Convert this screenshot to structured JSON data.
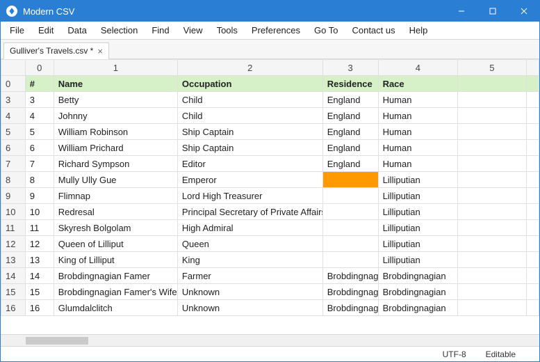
{
  "app": {
    "title": "Modern CSV"
  },
  "menu": [
    "File",
    "Edit",
    "Data",
    "Selection",
    "Find",
    "View",
    "Tools",
    "Preferences",
    "Go To",
    "Contact us",
    "Help"
  ],
  "tab": {
    "label": "Gulliver's Travels.csv *"
  },
  "colHeaders": [
    "0",
    "1",
    "2",
    "3",
    "4",
    "5"
  ],
  "headerRow": {
    "idx": "0",
    "c0": "#",
    "c1": "Name",
    "c2": "Occupation",
    "c3": "Residence",
    "c4": "Race"
  },
  "rows": [
    {
      "idx": "3",
      "c0": "3",
      "c1": "Betty",
      "c2": "Child",
      "c3": "England",
      "c4": "Human"
    },
    {
      "idx": "4",
      "c0": "4",
      "c1": "Johnny",
      "c2": "Child",
      "c3": "England",
      "c4": "Human"
    },
    {
      "idx": "5",
      "c0": "5",
      "c1": "William Robinson",
      "c2": "Ship Captain",
      "c3": "England",
      "c4": "Human"
    },
    {
      "idx": "6",
      "c0": "6",
      "c1": "William Prichard",
      "c2": "Ship Captain",
      "c3": "England",
      "c4": "Human"
    },
    {
      "idx": "7",
      "c0": "7",
      "c1": "Richard Sympson",
      "c2": "Editor",
      "c3": "England",
      "c4": "Human"
    },
    {
      "idx": "8",
      "c0": "8",
      "c1": "Mully Ully Gue",
      "c2": "Emperor",
      "c3": "",
      "c4": "Lilliputian",
      "hl3": true
    },
    {
      "idx": "9",
      "c0": "9",
      "c1": "Flimnap",
      "c2": "Lord High Treasurer",
      "c3": "",
      "c4": "Lilliputian"
    },
    {
      "idx": "10",
      "c0": "10",
      "c1": "Redresal",
      "c2": "Principal Secretary of Private Affairs",
      "c3": "",
      "c4": "Lilliputian"
    },
    {
      "idx": "11",
      "c0": "11",
      "c1": "Skyresh Bolgolam",
      "c2": "High Admiral",
      "c3": "",
      "c4": "Lilliputian"
    },
    {
      "idx": "12",
      "c0": "12",
      "c1": "Queen of Lilliput",
      "c2": "Queen",
      "c3": "",
      "c4": "Lilliputian"
    },
    {
      "idx": "13",
      "c0": "13",
      "c1": "King of Lilliput",
      "c2": "King",
      "c3": "",
      "c4": "Lilliputian"
    },
    {
      "idx": "14",
      "c0": "14",
      "c1": "Brobdingnagian Famer",
      "c2": "Farmer",
      "c3": "Brobdingnag",
      "c4": "Brobdingnagian"
    },
    {
      "idx": "15",
      "c0": "15",
      "c1": "Brobdingnagian Famer's Wife",
      "c2": "Unknown",
      "c3": "Brobdingnag",
      "c4": "Brobdingnagian"
    },
    {
      "idx": "16",
      "c0": "16",
      "c1": "Glumdalclitch",
      "c2": "Unknown",
      "c3": "Brobdingnag",
      "c4": "Brobdingnagian"
    }
  ],
  "status": {
    "encoding": "UTF-8",
    "mode": "Editable"
  }
}
